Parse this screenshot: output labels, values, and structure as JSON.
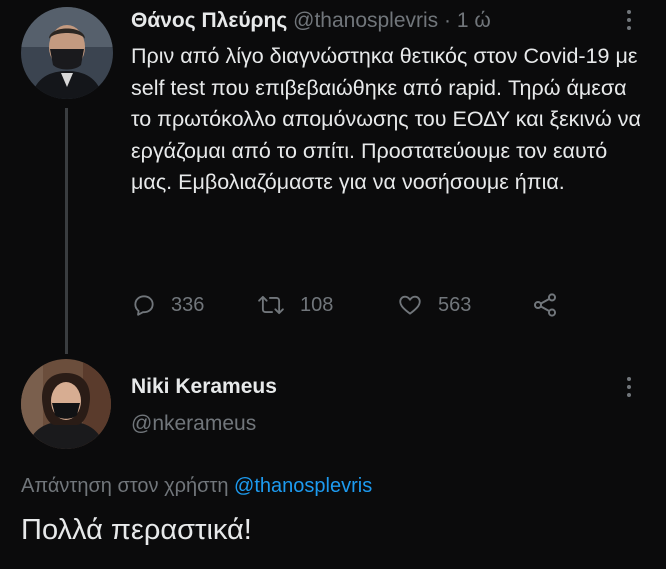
{
  "tweet1": {
    "author_name": "Θάνος Πλεύρης",
    "author_handle": "@thanosplevris",
    "separator": "·",
    "time": "1 ώ",
    "text": "Πριν από λίγο διαγνώστηκα θετικός στον Covid-19 με self test που επιβεβαιώθηκε από rapid. Τηρώ άμεσα το πρωτόκολλο απομόνωσης του ΕΟΔΥ και ξεκινώ να εργάζομαι από το σπίτι. Προστατεύουμε τον εαυτό μας. Εμβολιαζόμαστε για να νοσήσουμε ήπια.",
    "replies": "336",
    "retweets": "108",
    "likes": "563"
  },
  "tweet2": {
    "author_name": "Niki Kerameus",
    "author_handle": "@nkerameus",
    "reply_prefix": "Απάντηση στον χρήστη",
    "reply_mention": "@thanosplevris",
    "text": "Πολλά περαστικά!"
  },
  "icons": {
    "reply": "reply-icon",
    "retweet": "retweet-icon",
    "like": "heart-icon",
    "share": "share-icon",
    "more": "more-icon"
  },
  "colors": {
    "background": "#0b0b0c",
    "text": "#e7e9ea",
    "muted": "#71767b",
    "link": "#1d9bf0"
  }
}
